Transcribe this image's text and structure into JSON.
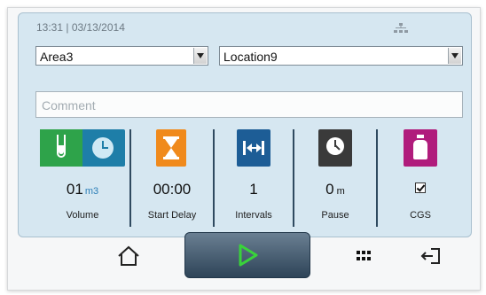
{
  "status": {
    "datetime": "13:31 | 03/13/2014",
    "network_icon": "network-icon"
  },
  "selectors": {
    "area": "Area3",
    "location": "Location9"
  },
  "comment": {
    "placeholder": "Comment"
  },
  "params": [
    {
      "name": "volume",
      "value": "01",
      "unit": "m3",
      "label": "Volume",
      "icon": "tube-clock-icon",
      "color": "#2ea34a"
    },
    {
      "name": "start-delay",
      "value": "00:00",
      "unit": "",
      "label": "Start Delay",
      "icon": "hourglass-icon",
      "color": "#f08a1c"
    },
    {
      "name": "intervals",
      "value": "1",
      "unit": "",
      "label": "Intervals",
      "icon": "interval-icon",
      "color": "#1d5d96"
    },
    {
      "name": "pause",
      "value": "0",
      "unit": "m",
      "label": "Pause",
      "icon": "clock-icon",
      "color": "#3a3a3a"
    },
    {
      "name": "cgs",
      "value": "",
      "unit": "",
      "label": "CGS",
      "icon": "bottle-icon",
      "color": "#b01c7c",
      "checked": true
    }
  ],
  "nav": {
    "home": "home-icon",
    "play": "play-icon",
    "apps": "grid-icon",
    "logout": "logout-icon"
  },
  "colors": {
    "panel": "#d6e7f1",
    "play_accent": "#39d33a"
  }
}
